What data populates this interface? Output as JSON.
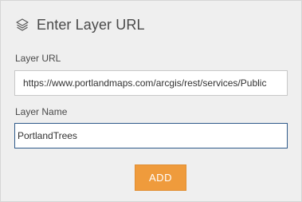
{
  "header": {
    "icon": "layers-icon",
    "title": "Enter Layer URL"
  },
  "form": {
    "url_label": "Layer URL",
    "url_value": "https://www.portlandmaps.com/arcgis/rest/services/Public",
    "name_label": "Layer Name",
    "name_value": "PortlandTrees"
  },
  "actions": {
    "add_label": "ADD"
  },
  "colors": {
    "panel_bg": "#efefef",
    "accent_button": "#ef9b3c",
    "focused_border": "#2f5a8a"
  }
}
